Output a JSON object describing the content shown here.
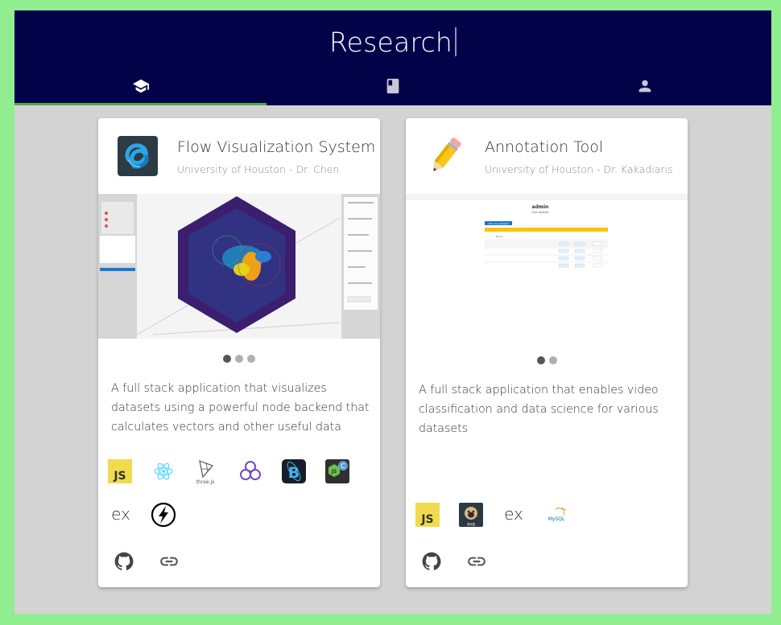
{
  "header": {
    "title": "Research",
    "tabs": [
      {
        "name": "research",
        "icon": "graduation-cap-icon",
        "active": true
      },
      {
        "name": "publications",
        "icon": "book-icon",
        "active": false
      },
      {
        "name": "profile",
        "icon": "person-icon",
        "active": false
      }
    ]
  },
  "colors": {
    "page_background": "#90ee90",
    "header_background": "#020249",
    "content_background": "#d3d3d3",
    "tab_indicator": "#4caf50"
  },
  "cards": [
    {
      "title": "Flow Visualization System",
      "subtitle": "University of Houston - Dr. Chen",
      "icon": "knot-logo-icon",
      "carousel": {
        "slides": 3,
        "active_index": 0
      },
      "description": "A full stack application that visualizes datasets using a powerful node backend that calculates vectors and other useful data",
      "technologies": [
        {
          "name": "javascript-icon",
          "text": "JS"
        },
        {
          "name": "react-icon",
          "text": ""
        },
        {
          "name": "threejs-icon",
          "text": "three.js"
        },
        {
          "name": "redux-icon",
          "text": ""
        },
        {
          "name": "bootstrap-react-icon",
          "text": ""
        },
        {
          "name": "nodejs-icon",
          "text": "JS"
        },
        {
          "name": "express-icon",
          "text": "ex"
        },
        {
          "name": "socketio-icon",
          "text": ""
        }
      ],
      "links": [
        "github-icon",
        "link-icon"
      ]
    },
    {
      "title": "Annotation Tool",
      "subtitle": "University of Houston - Dr. Kakadiaris",
      "icon": "pencil-icon",
      "carousel": {
        "slides": 2,
        "active_index": 0
      },
      "description": "A full stack application that enables video classification and data science for various datasets",
      "screenshot": {
        "heading": "admin",
        "subheading": "Edit dataset",
        "add_button": "Add new dataset",
        "table_header": "Name"
      },
      "technologies": [
        {
          "name": "javascript-icon",
          "text": "JS"
        },
        {
          "name": "pug-icon",
          "text": "pug"
        },
        {
          "name": "express-icon",
          "text": "ex"
        },
        {
          "name": "mysql-icon",
          "text": "MySQL"
        }
      ],
      "links": [
        "github-icon",
        "link-icon"
      ]
    }
  ]
}
